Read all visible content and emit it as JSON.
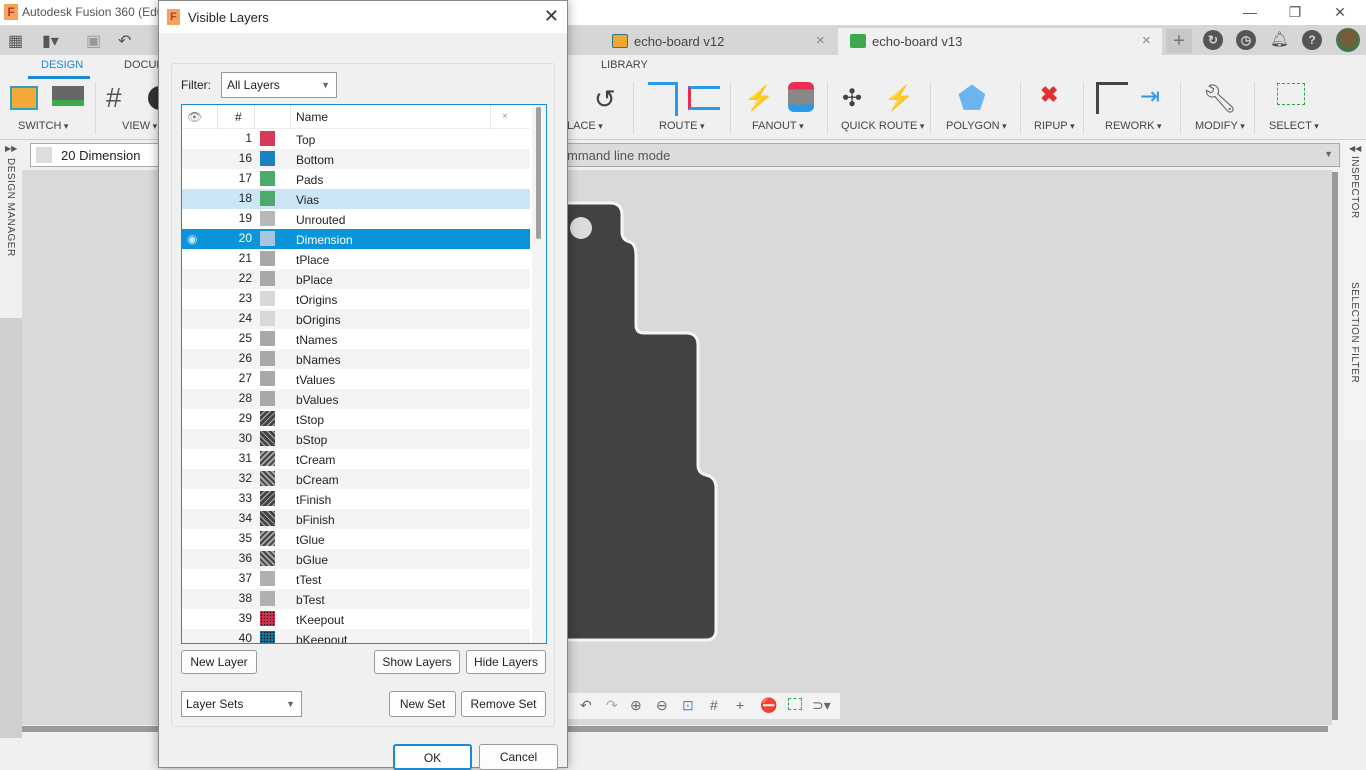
{
  "app": {
    "title": "Autodesk Fusion 360 (Edu",
    "logo": "F",
    "window_controls": {
      "minimize": "—",
      "restore": "❐",
      "close": "✕"
    }
  },
  "document_tabs": [
    {
      "label": "echo-board v12",
      "icon_color": "#f0a830",
      "active": false
    },
    {
      "label": "echo-board v13",
      "icon_color": "#3caa4a",
      "active": true
    }
  ],
  "ribbon": {
    "tabs": [
      "DESIGN",
      "DOCUM",
      "LIBRARY"
    ],
    "active_tab": "DESIGN",
    "groups": [
      "SWITCH",
      "VIEW",
      "LACE",
      "ROUTE",
      "FANOUT",
      "QUICK ROUTE",
      "POLYGON",
      "RIPUP",
      "REWORK",
      "MODIFY",
      "SELECT"
    ]
  },
  "command_bar": {
    "current_layer": "20 Dimension",
    "command_placeholder": "mmand line mode"
  },
  "side_panels": {
    "left": "DESIGN MANAGER",
    "right_top": "INSPECTOR",
    "right_bottom": "SELECTION FILTER"
  },
  "dialog": {
    "title": "Visible Layers",
    "filter_label": "Filter:",
    "filter_value": "All Layers",
    "columns": {
      "visible": "👁",
      "number": "#",
      "name": "Name",
      "close": "×"
    },
    "layers": [
      {
        "num": "1",
        "name": "Top",
        "color": "#d63a5a",
        "pattern": "solid"
      },
      {
        "num": "16",
        "name": "Bottom",
        "color": "#1f80c0",
        "pattern": "solid"
      },
      {
        "num": "17",
        "name": "Pads",
        "color": "#4caa6a",
        "pattern": "solid"
      },
      {
        "num": "18",
        "name": "Vias",
        "color": "#4caa6a",
        "pattern": "solid",
        "state": "hover"
      },
      {
        "num": "19",
        "name": "Unrouted",
        "color": "#b8b8b8",
        "pattern": "solid"
      },
      {
        "num": "20",
        "name": "Dimension",
        "color": "#a8c4de",
        "pattern": "solid",
        "state": "selected",
        "visible": true
      },
      {
        "num": "21",
        "name": "tPlace",
        "color": "#a8a8a8",
        "pattern": "solid"
      },
      {
        "num": "22",
        "name": "bPlace",
        "color": "#a8a8a8",
        "pattern": "solid"
      },
      {
        "num": "23",
        "name": "tOrigins",
        "color": "#d8d8d8",
        "pattern": "solid"
      },
      {
        "num": "24",
        "name": "bOrigins",
        "color": "#d8d8d8",
        "pattern": "solid"
      },
      {
        "num": "25",
        "name": "tNames",
        "color": "#a8a8a8",
        "pattern": "solid"
      },
      {
        "num": "26",
        "name": "bNames",
        "color": "#a8a8a8",
        "pattern": "solid"
      },
      {
        "num": "27",
        "name": "tValues",
        "color": "#a8a8a8",
        "pattern": "solid"
      },
      {
        "num": "28",
        "name": "bValues",
        "color": "#a8a8a8",
        "pattern": "solid"
      },
      {
        "num": "29",
        "name": "tStop",
        "color": "#444444",
        "pattern": "hatch-f"
      },
      {
        "num": "30",
        "name": "bStop",
        "color": "#444444",
        "pattern": "hatch-b"
      },
      {
        "num": "31",
        "name": "tCream",
        "color": "#444444",
        "pattern": "hatch-fd"
      },
      {
        "num": "32",
        "name": "bCream",
        "color": "#444444",
        "pattern": "hatch-bd"
      },
      {
        "num": "33",
        "name": "tFinish",
        "color": "#444444",
        "pattern": "hatch-f"
      },
      {
        "num": "34",
        "name": "bFinish",
        "color": "#444444",
        "pattern": "hatch-b"
      },
      {
        "num": "35",
        "name": "tGlue",
        "color": "#444444",
        "pattern": "hatch-fd"
      },
      {
        "num": "36",
        "name": "bGlue",
        "color": "#444444",
        "pattern": "hatch-bd"
      },
      {
        "num": "37",
        "name": "tTest",
        "color": "#b0b0b0",
        "pattern": "solid"
      },
      {
        "num": "38",
        "name": "bTest",
        "color": "#b0b0b0",
        "pattern": "solid"
      },
      {
        "num": "39",
        "name": "tKeepout",
        "color": "#c8304e",
        "pattern": "dots-r"
      },
      {
        "num": "40",
        "name": "bKeepout",
        "color": "#1f6a8f",
        "pattern": "dots-b"
      }
    ],
    "buttons": {
      "new_layer": "New Layer",
      "show_layers": "Show Layers",
      "hide_layers": "Hide Layers",
      "new_set": "New Set",
      "remove_set": "Remove Set",
      "ok": "OK",
      "cancel": "Cancel"
    },
    "layer_sets_value": "Layer Sets"
  },
  "colors": {
    "accent": "#1a8ad4",
    "selected_row": "#0b95d9",
    "hover_row": "#cce6f5",
    "board": "#424242"
  }
}
